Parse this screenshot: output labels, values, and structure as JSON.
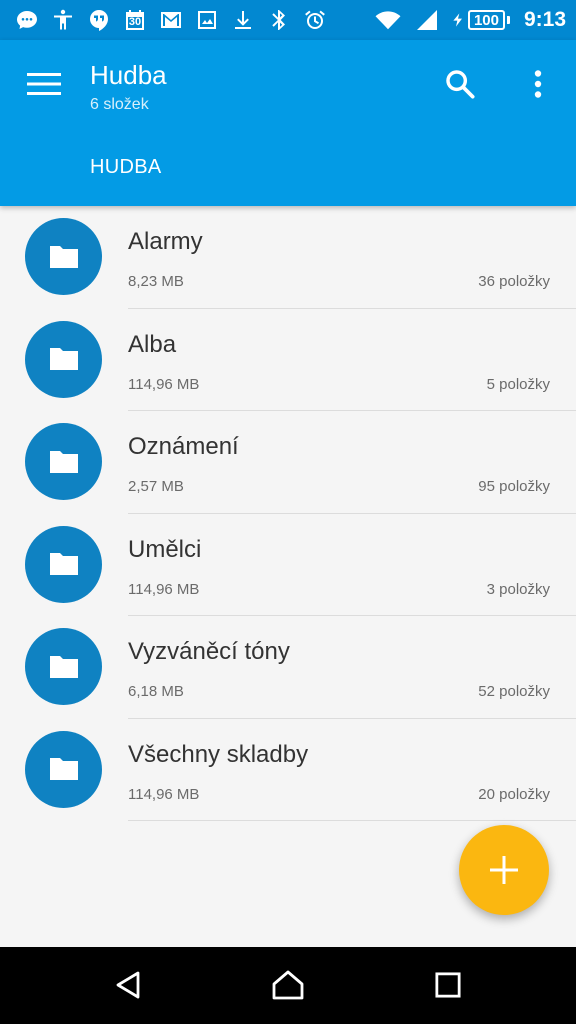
{
  "status_bar": {
    "icons": [
      "messenger-icon",
      "accessibility-icon",
      "hangouts-icon",
      "calendar-icon",
      "gmail-icon",
      "image-icon",
      "download-icon",
      "bluetooth-icon",
      "alarm-icon",
      "wifi-icon",
      "signal-icon",
      "charging-icon"
    ],
    "calendar_day": "30",
    "battery": "100",
    "time": "9:13"
  },
  "app_bar": {
    "title": "Hudba",
    "subtitle": "6 složek",
    "breadcrumb": "HUDBA",
    "color": "#039be5"
  },
  "folders": [
    {
      "name": "Alarmy",
      "size": "8,23 MB",
      "count": "36 položky"
    },
    {
      "name": "Alba",
      "size": "114,96 MB",
      "count": "5 položky"
    },
    {
      "name": "Oznámení",
      "size": "2,57 MB",
      "count": "95 položky"
    },
    {
      "name": "Umělci",
      "size": "114,96 MB",
      "count": "3 položky"
    },
    {
      "name": "Vyzváněcí tóny",
      "size": "6,18 MB",
      "count": "52 položky"
    },
    {
      "name": "Všechny skladby",
      "size": "114,96 MB",
      "count": "20 položky"
    }
  ],
  "fab": {
    "icon": "plus-icon",
    "color": "#fbb710"
  },
  "nav_bar": {
    "icons": [
      "back-icon",
      "home-icon",
      "recent-apps-icon"
    ]
  }
}
